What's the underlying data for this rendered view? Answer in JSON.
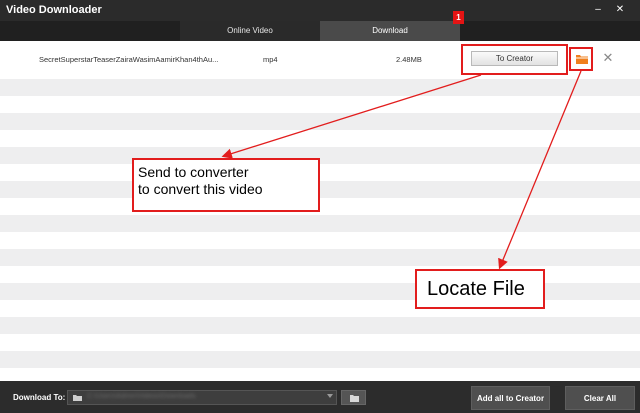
{
  "window": {
    "title": "Video Downloader",
    "minimize_symbol": "–",
    "close_symbol": "✕"
  },
  "tabs": [
    {
      "label": "Online Video",
      "active": false
    },
    {
      "label": "Download",
      "active": true,
      "badge": "1"
    }
  ],
  "downloads": [
    {
      "name": "SecretSuperstarTeaserZairaWasimAamirKhan4thAu...",
      "format": "mp4",
      "size": "2.48MB",
      "action_label": "To Creator",
      "folder_icon": "folder-icon",
      "remove_symbol": "✕"
    }
  ],
  "annotations": {
    "send_note_line1": "Send to converter",
    "send_note_line2": "to convert this video",
    "locate_note": "Locate File",
    "color": "#e21d1d"
  },
  "bottom_bar": {
    "download_to_label": "Download To:",
    "path_value": "C:\\Users\\Admin\\Videos\\Downloads",
    "add_all_label": "Add all to Creator",
    "clear_all_label": "Clear All"
  },
  "colors": {
    "titlebar": "#2b2b2b",
    "active_tab": "#4a4a4a",
    "badge": "#e41414",
    "folder_orange": "#f0801e",
    "row_stripe": "#eeeeef"
  }
}
